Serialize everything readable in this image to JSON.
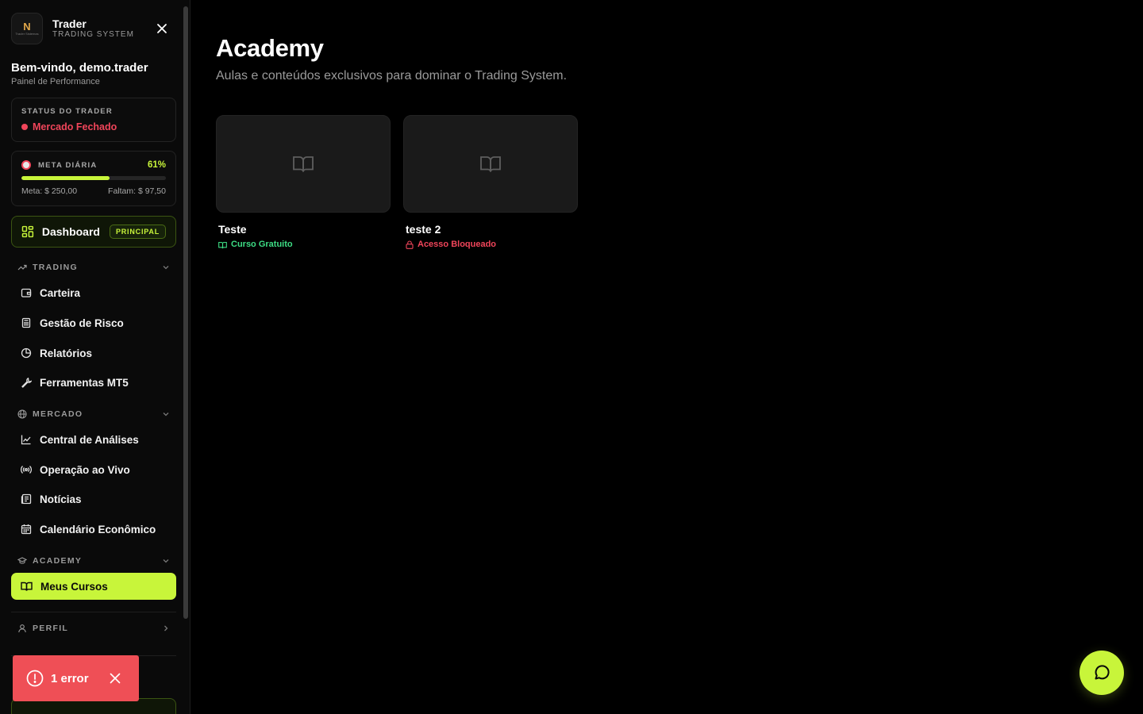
{
  "brand": {
    "logo_mark": "N",
    "logo_small": "Trader Sistemas",
    "name": "Trader",
    "subtitle": "TRADING SYSTEM"
  },
  "welcome": {
    "title": "Bem-vindo, demo.trader",
    "subtitle": "Painel de Performance"
  },
  "status": {
    "label": "STATUS DO TRADER",
    "value": "Mercado Fechado",
    "color": "#f0455a"
  },
  "meta": {
    "label": "META DIÁRIA",
    "percent_label": "61%",
    "progress": 0.61,
    "goal": "Meta: $ 250,00",
    "remaining": "Faltam: $ 97,50"
  },
  "dashboard": {
    "label": "Dashboard",
    "badge": "PRINCIPAL"
  },
  "sections": {
    "trading": {
      "label": "TRADING",
      "items": [
        {
          "label": "Carteira",
          "icon": "wallet-icon"
        },
        {
          "label": "Gestão de Risco",
          "icon": "calculator-icon"
        },
        {
          "label": "Relatórios",
          "icon": "pie-chart-icon"
        },
        {
          "label": "Ferramentas MT5",
          "icon": "wrench-icon"
        }
      ]
    },
    "mercado": {
      "label": "MERCADO",
      "items": [
        {
          "label": "Central de Análises",
          "icon": "line-chart-icon"
        },
        {
          "label": "Operação ao Vivo",
          "icon": "radio-icon"
        },
        {
          "label": "Notícias",
          "icon": "newspaper-icon"
        },
        {
          "label": "Calendário Econômico",
          "icon": "calendar-icon"
        }
      ]
    },
    "academy": {
      "label": "ACADEMY",
      "items": [
        {
          "label": "Meus Cursos",
          "icon": "book-open-icon",
          "active": true
        }
      ]
    },
    "perfil": {
      "label": "PERFIL"
    }
  },
  "toast": {
    "text": "1 error"
  },
  "page": {
    "title": "Academy",
    "subtitle": "Aulas e conteúdos exclusivos para dominar o Trading System."
  },
  "courses": [
    {
      "title": "Teste",
      "tag": "Curso Gratuito",
      "tag_color": "#3ddc84"
    },
    {
      "title": "teste 2",
      "tag": "Acesso Bloqueado",
      "tag_color": "#f0455a"
    }
  ],
  "colors": {
    "accent": "#c8f53a",
    "danger": "#f0455a",
    "success": "#3ddc84"
  }
}
